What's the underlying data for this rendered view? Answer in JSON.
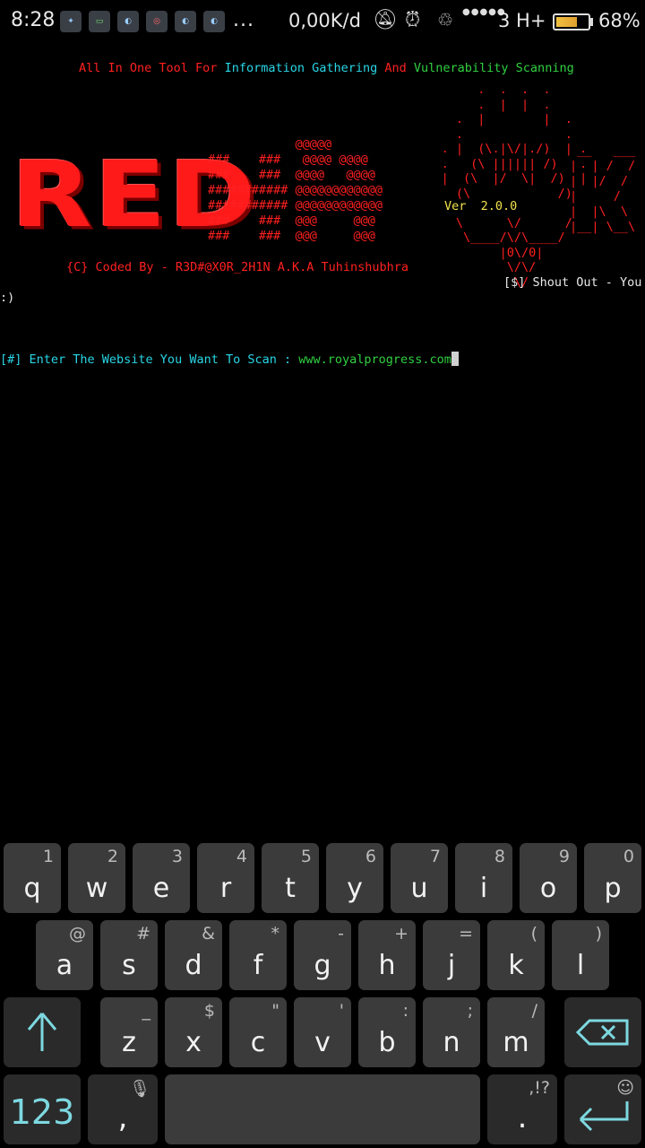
{
  "status_bar": {
    "time": "8:28",
    "more": "...",
    "speed": "0,00K/d",
    "network": "3 H+",
    "battery_pct": "68%",
    "battery_level": 0.68
  },
  "terminal": {
    "tagline": {
      "p1": "All In One Tool For ",
      "p2": "Information Gathering ",
      "p3": "And ",
      "p4": "Vulnerability Scanning"
    },
    "logo_word": "RED",
    "ascii_hash": [
      "            @@@@@",
      "###    ###   @@@@ @@@@",
      "###    ###  @@@@   @@@@",
      "########### @@@@@@@@@@@@",
      "########### @@@@@@@@@@@@",
      "###    ###  @@@     @@@",
      "###    ###  @@@     @@@"
    ],
    "ascii_skull": [
      "          .  .  .  .",
      "          .  |  |  .",
      "       .  |        |  .",
      "       .              .",
      "     . |  (\\.|\\/|./)  | .",
      "     .   (\\ |||||| /)   .",
      "     |  (\\  |/  \\|  /)  |",
      "       (\\            /)",
      "      (\\  Ver  2.0.0  /)",
      "       \\      \\/      /",
      "        \\____/\\/\\____/",
      "             |0\\/0|",
      "              \\/\\/",
      "               \\/"
    ],
    "ascii_k": [
      " __   ___",
      "|  | /  /",
      "|  |/  /",
      "|     /",
      "|  |\\  \\",
      "|__| \\__\\"
    ],
    "version": "Ver  2.0.0",
    "coded_by": "{C} Coded By - R3D#@X0R_2H1N A.K.A Tuhinshubhra",
    "shout_out": "[$] Shout Out - You",
    "smiley": ":)",
    "prompt": "[#] Enter The Website You Want To Scan : ",
    "input_value": "www.royalprogress.com"
  },
  "keyboard": {
    "row1": [
      {
        "k": "q",
        "h": "1"
      },
      {
        "k": "w",
        "h": "2"
      },
      {
        "k": "e",
        "h": "3"
      },
      {
        "k": "r",
        "h": "4"
      },
      {
        "k": "t",
        "h": "5"
      },
      {
        "k": "y",
        "h": "6"
      },
      {
        "k": "u",
        "h": "7"
      },
      {
        "k": "i",
        "h": "8"
      },
      {
        "k": "o",
        "h": "9"
      },
      {
        "k": "p",
        "h": "0"
      }
    ],
    "row2": [
      {
        "k": "a",
        "h": "@"
      },
      {
        "k": "s",
        "h": "#"
      },
      {
        "k": "d",
        "h": "&"
      },
      {
        "k": "f",
        "h": "*"
      },
      {
        "k": "g",
        "h": "-"
      },
      {
        "k": "h",
        "h": "+"
      },
      {
        "k": "j",
        "h": "="
      },
      {
        "k": "k",
        "h": "("
      },
      {
        "k": "l",
        "h": ")"
      }
    ],
    "row3": [
      {
        "k": "z",
        "h": "_"
      },
      {
        "k": "x",
        "h": "$"
      },
      {
        "k": "c",
        "h": "\""
      },
      {
        "k": "v",
        "h": "'"
      },
      {
        "k": "b",
        "h": ":"
      },
      {
        "k": "n",
        "h": ";"
      },
      {
        "k": "m",
        "h": "/"
      }
    ],
    "numbers_label": "123",
    "comma": ",",
    "period": ".",
    "punct_hint": ",!?"
  },
  "colors": {
    "terminal_red": "#ff2020",
    "terminal_cyan": "#28d6e6",
    "terminal_green": "#30d040",
    "terminal_yellow": "#f2e24a",
    "key_bg": "#3b3b3b",
    "key_accent": "#7dd8e0"
  }
}
